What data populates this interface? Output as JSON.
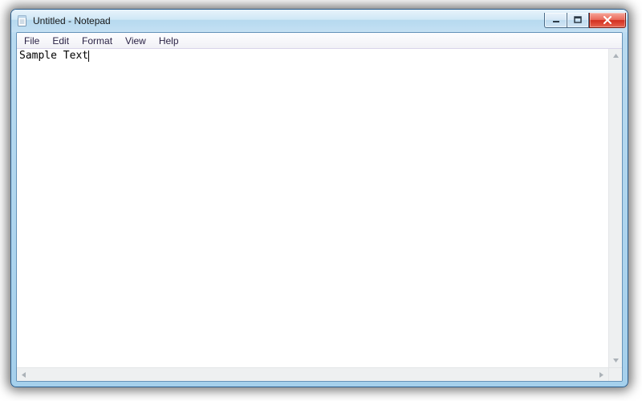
{
  "window": {
    "title": "Untitled - Notepad"
  },
  "menu": {
    "file": "File",
    "edit": "Edit",
    "format": "Format",
    "view": "View",
    "help": "Help"
  },
  "editor": {
    "content": "Sample Text"
  }
}
